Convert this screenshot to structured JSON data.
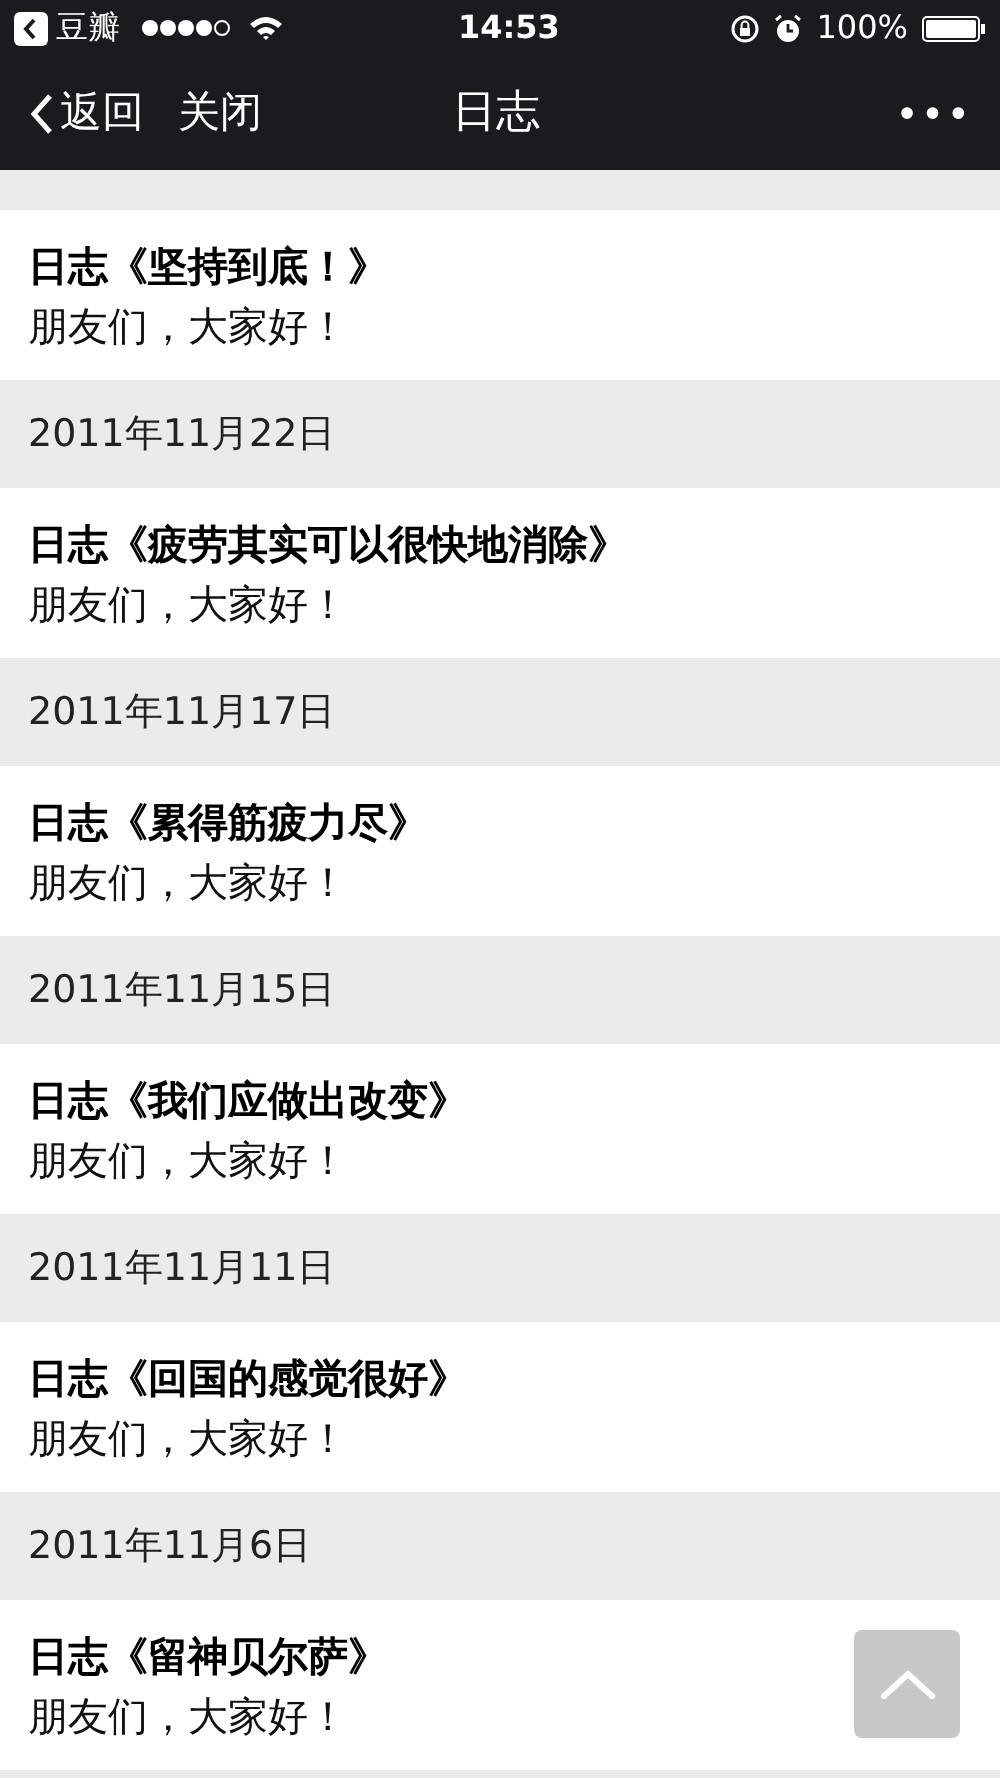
{
  "status_bar": {
    "back_app": "豆瓣",
    "time": "14:53",
    "battery": "100%"
  },
  "nav_bar": {
    "back": "返回",
    "close": "关闭",
    "title": "日志",
    "more": "•••"
  },
  "entries": [
    {
      "title": "日志《坚持到底！》",
      "summary": "朋友们，大家好！"
    },
    {
      "date": "2011年11月22日",
      "title": "日志《疲劳其实可以很快地消除》",
      "summary": "朋友们，大家好！"
    },
    {
      "date": "2011年11月17日",
      "title": "日志《累得筋疲力尽》",
      "summary": "朋友们，大家好！"
    },
    {
      "date": "2011年11月15日",
      "title": "日志《我们应做出改变》",
      "summary": "朋友们，大家好！"
    },
    {
      "date": "2011年11月11日",
      "title": "日志《回国的感觉很好》",
      "summary": "朋友们，大家好！"
    },
    {
      "date": "2011年11月6日",
      "title": "日志《留神贝尔萨》",
      "summary": "朋友们，大家好！"
    }
  ]
}
